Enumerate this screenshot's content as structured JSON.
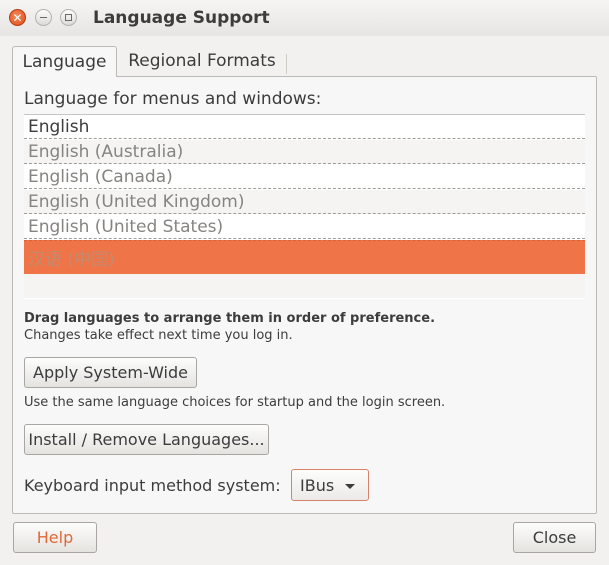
{
  "window": {
    "title": "Language Support"
  },
  "tabs": [
    {
      "label": "Language",
      "active": true
    },
    {
      "label": "Regional Formats",
      "active": false
    }
  ],
  "language_tab": {
    "list_label": "Language for menus and windows:",
    "languages": [
      "English",
      "English (Australia)",
      "English (Canada)",
      "English (United Kingdom)",
      "English (United States)",
      "汉语 (中国)"
    ],
    "selected_index": 5,
    "hint_bold": "Drag languages to arrange them in order of preference.",
    "hint_normal": "Changes take effect next time you log in.",
    "apply_button": "Apply System-Wide",
    "apply_desc": "Use the same language choices for startup and the login screen.",
    "install_button": "Install / Remove Languages...",
    "input_method_label": "Keyboard input method system:",
    "input_method_value": "IBus"
  },
  "footer": {
    "help_button": "Help",
    "close_button": "Close"
  },
  "colors": {
    "accent": "#ef7447",
    "window_close": "#df4b16",
    "help_text": "#e0693a"
  }
}
